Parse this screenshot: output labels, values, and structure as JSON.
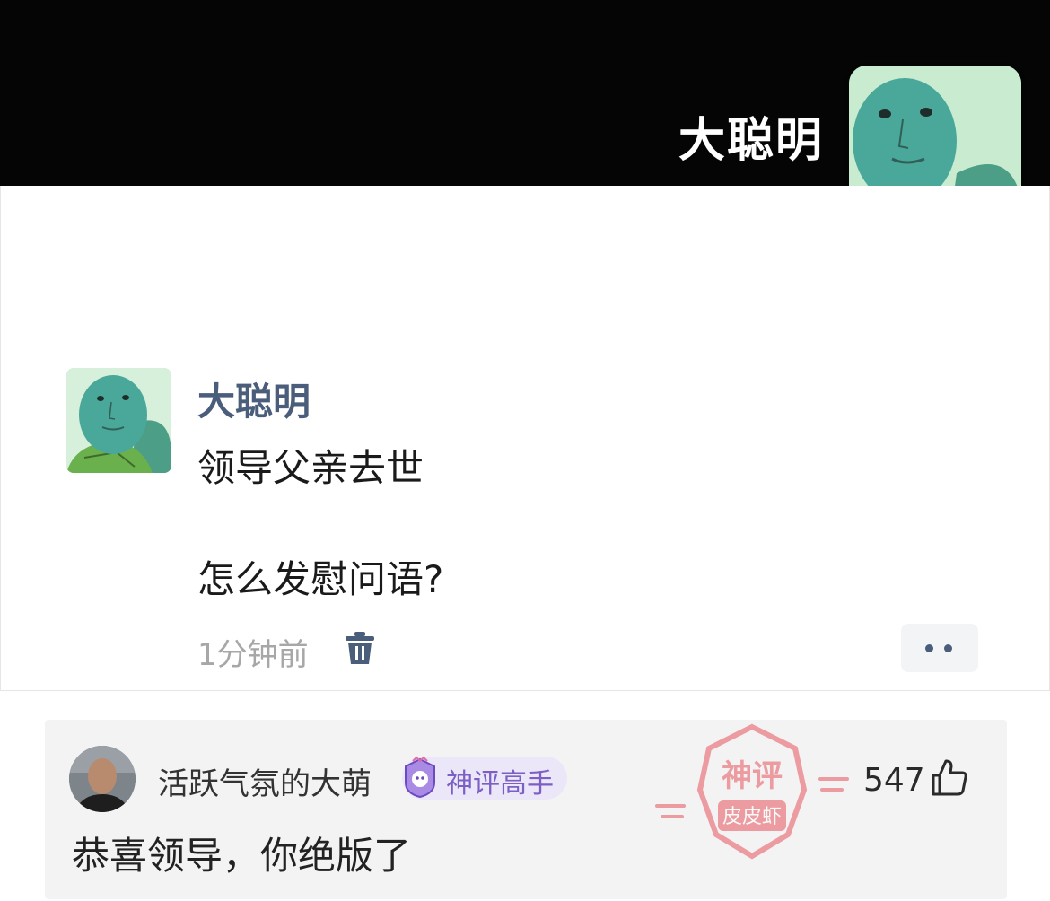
{
  "header": {
    "name": "大聪明",
    "avatar_icon": "turtle-face-avatar"
  },
  "post": {
    "author": "大聪明",
    "avatar_icon": "turtle-face-avatar",
    "lines": [
      "领导父亲去世",
      "怎么发慰问语?"
    ],
    "time": "1分钟前",
    "delete_icon": "trash-icon",
    "more_icon": "more-dots-icon"
  },
  "comment": {
    "username": "活跃气氛的大萌",
    "badge": "神评高手",
    "likes": "547",
    "text": "恭喜领导，你绝版了",
    "stamp_top": "神评",
    "stamp_bottom": "皮皮虾"
  },
  "colors": {
    "header_bg": "#050505",
    "author": "#4a5d7a",
    "badge_bg": "#ece6f9",
    "badge_text": "#7b5fc5",
    "stamp": "#e8545c"
  }
}
